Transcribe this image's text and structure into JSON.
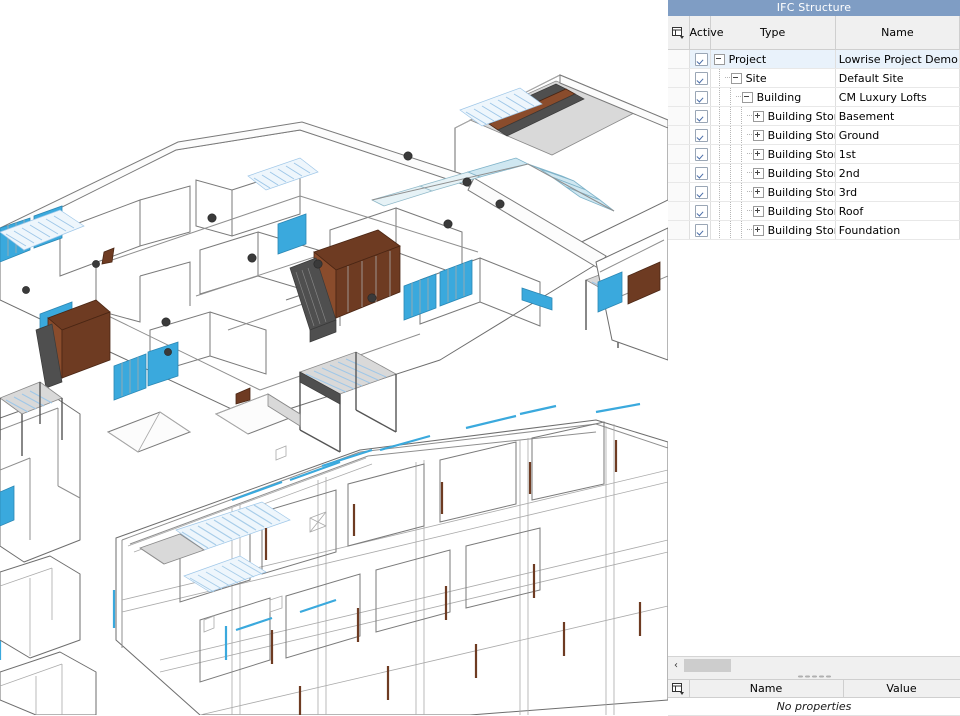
{
  "viewport": {
    "name": "3d-model-viewport",
    "background": "#ffffff",
    "description": "Axonometric BIM model of a multi-storey residential building with exploded floor plates",
    "colors": {
      "wall_line": "#6e6e6e",
      "wall_fill": "#ffffff",
      "glass": "#3aa9dd",
      "glass_pale": "#ddeef4",
      "wood": "#6e3b22",
      "roof_dark": "#4a4a4a",
      "stair_blue": "#9fc7e8",
      "slab_grey": "#d8d8d8",
      "fixture": "#3a3a3a"
    }
  },
  "dock": {
    "title": "IFC Structure",
    "title_bar_color": "#7f9dc4",
    "tree": {
      "columns": [
        {
          "id": "config",
          "label": "",
          "icon": "column-config-icon"
        },
        {
          "id": "active",
          "label": "Active"
        },
        {
          "id": "type",
          "label": "Type"
        },
        {
          "id": "name",
          "label": "Name"
        }
      ],
      "rows": [
        {
          "type": "Project",
          "name": "Lowrise Project Demo",
          "active": true,
          "depth": 0,
          "expander": "minus",
          "selected": true
        },
        {
          "type": "Site",
          "name": "Default Site",
          "active": true,
          "depth": 1,
          "expander": "minus",
          "selected": false
        },
        {
          "type": "Building",
          "name": "CM Luxury Lofts",
          "active": true,
          "depth": 2,
          "expander": "minus",
          "selected": false
        },
        {
          "type": "Building Storey",
          "name": "Basement",
          "active": true,
          "depth": 3,
          "expander": "plus",
          "selected": false
        },
        {
          "type": "Building Storey",
          "name": "Ground",
          "active": true,
          "depth": 3,
          "expander": "plus",
          "selected": false
        },
        {
          "type": "Building Storey",
          "name": "1st",
          "active": true,
          "depth": 3,
          "expander": "plus",
          "selected": false
        },
        {
          "type": "Building Storey",
          "name": "2nd",
          "active": true,
          "depth": 3,
          "expander": "plus",
          "selected": false
        },
        {
          "type": "Building Storey",
          "name": "3rd",
          "active": true,
          "depth": 3,
          "expander": "plus",
          "selected": false
        },
        {
          "type": "Building Storey",
          "name": "Roof",
          "active": true,
          "depth": 3,
          "expander": "plus",
          "selected": false
        },
        {
          "type": "Building Storey",
          "name": "Foundation",
          "active": true,
          "depth": 3,
          "expander": "plus",
          "selected": false
        }
      ]
    },
    "hscrollbar": {
      "left_arrow": "‹"
    },
    "properties": {
      "columns": [
        {
          "id": "config",
          "label": "",
          "icon": "column-config-icon"
        },
        {
          "id": "name",
          "label": "Name"
        },
        {
          "id": "value",
          "label": "Value"
        }
      ],
      "empty_message": "No properties"
    }
  }
}
